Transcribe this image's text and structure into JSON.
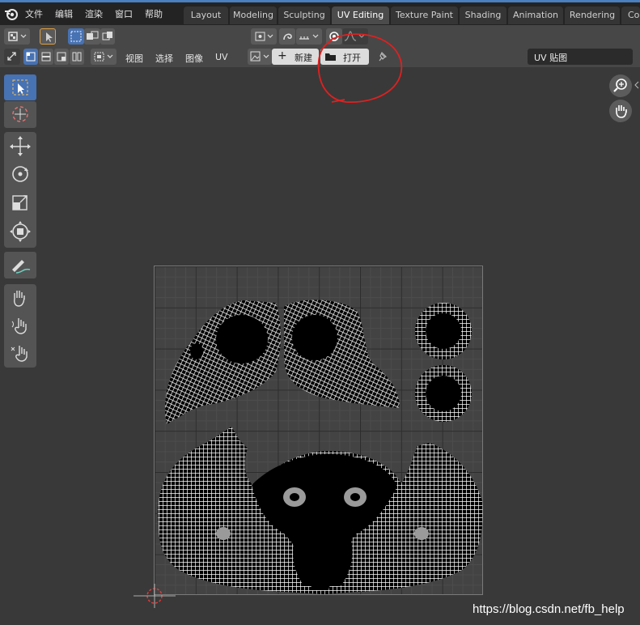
{
  "menubar": {
    "items": [
      "文件",
      "编辑",
      "渲染",
      "窗口",
      "帮助"
    ]
  },
  "workspace_tabs": [
    {
      "label": "Layout",
      "active": false
    },
    {
      "label": "Modeling",
      "active": false
    },
    {
      "label": "Sculpting",
      "active": false
    },
    {
      "label": "UV Editing",
      "active": true
    },
    {
      "label": "Texture Paint",
      "active": false
    },
    {
      "label": "Shading",
      "active": false
    },
    {
      "label": "Animation",
      "active": false
    },
    {
      "label": "Rendering",
      "active": false
    },
    {
      "label": "Co",
      "active": false
    }
  ],
  "header": {
    "menus": [
      "视图",
      "选择",
      "图像",
      "UV"
    ],
    "new_label": "新建",
    "open_label": "打开",
    "image_name": "UV 贴图"
  },
  "toolbar": {
    "tools": [
      "select-box",
      "cursor",
      "move",
      "rotate",
      "scale",
      "transform",
      "annotate",
      "grab",
      "relax",
      "pinch"
    ]
  },
  "watermark": "https://blog.csdn.net/fb_help",
  "colors": {
    "accent": "#4772b3",
    "annotation": "#e02020",
    "background": "#393939",
    "header": "#474747"
  }
}
